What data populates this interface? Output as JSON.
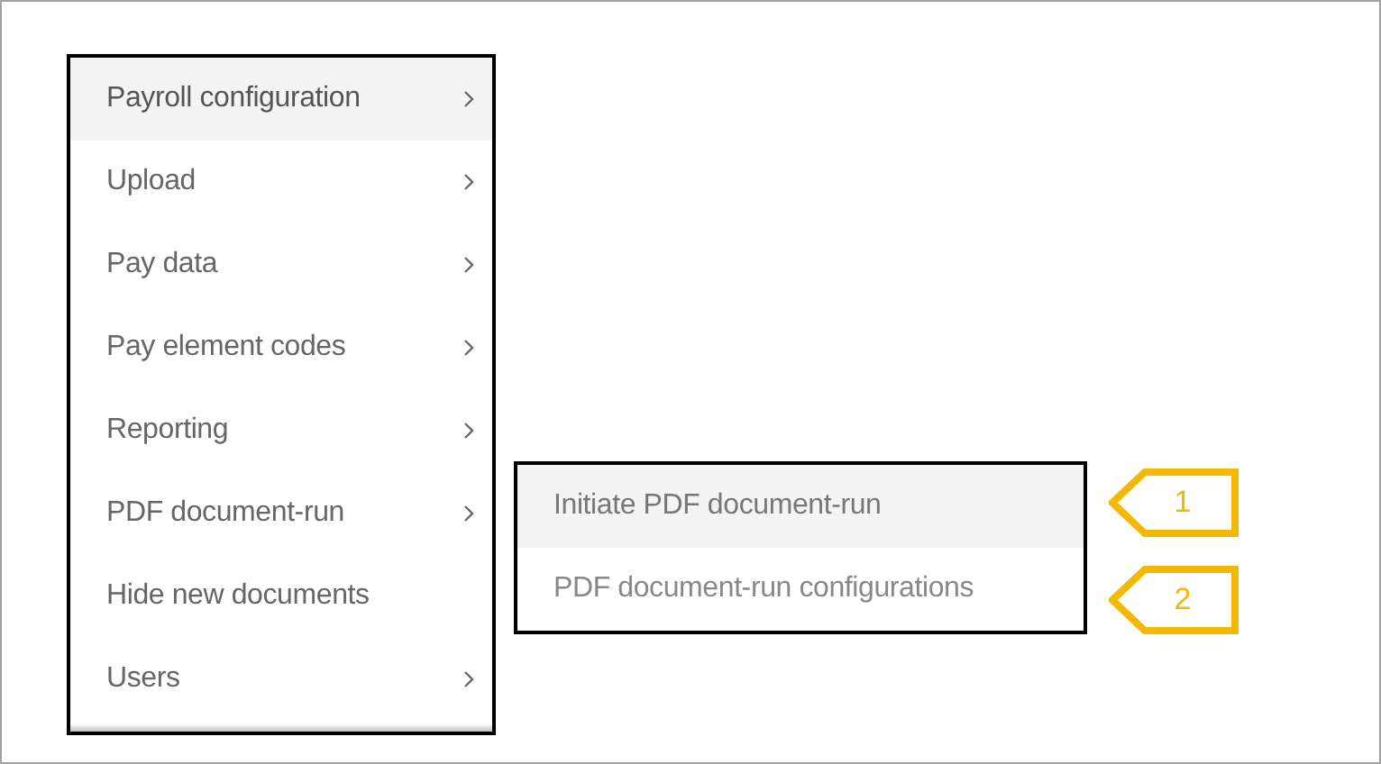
{
  "menu": {
    "items": [
      {
        "label": "Payroll configuration",
        "selected": true,
        "has_submenu": true
      },
      {
        "label": "Upload",
        "selected": false,
        "has_submenu": true
      },
      {
        "label": "Pay data",
        "selected": false,
        "has_submenu": true
      },
      {
        "label": "Pay element codes",
        "selected": false,
        "has_submenu": true
      },
      {
        "label": "Reporting",
        "selected": false,
        "has_submenu": true
      },
      {
        "label": "PDF document-run",
        "selected": false,
        "has_submenu": true
      },
      {
        "label": "Hide new documents",
        "selected": false,
        "has_submenu": false
      },
      {
        "label": "Users",
        "selected": false,
        "has_submenu": true
      }
    ]
  },
  "submenu": {
    "items": [
      {
        "label": "Initiate PDF document-run",
        "selected": true,
        "callout": "1"
      },
      {
        "label": "PDF document-run configurations",
        "selected": false,
        "callout": "2"
      }
    ]
  }
}
